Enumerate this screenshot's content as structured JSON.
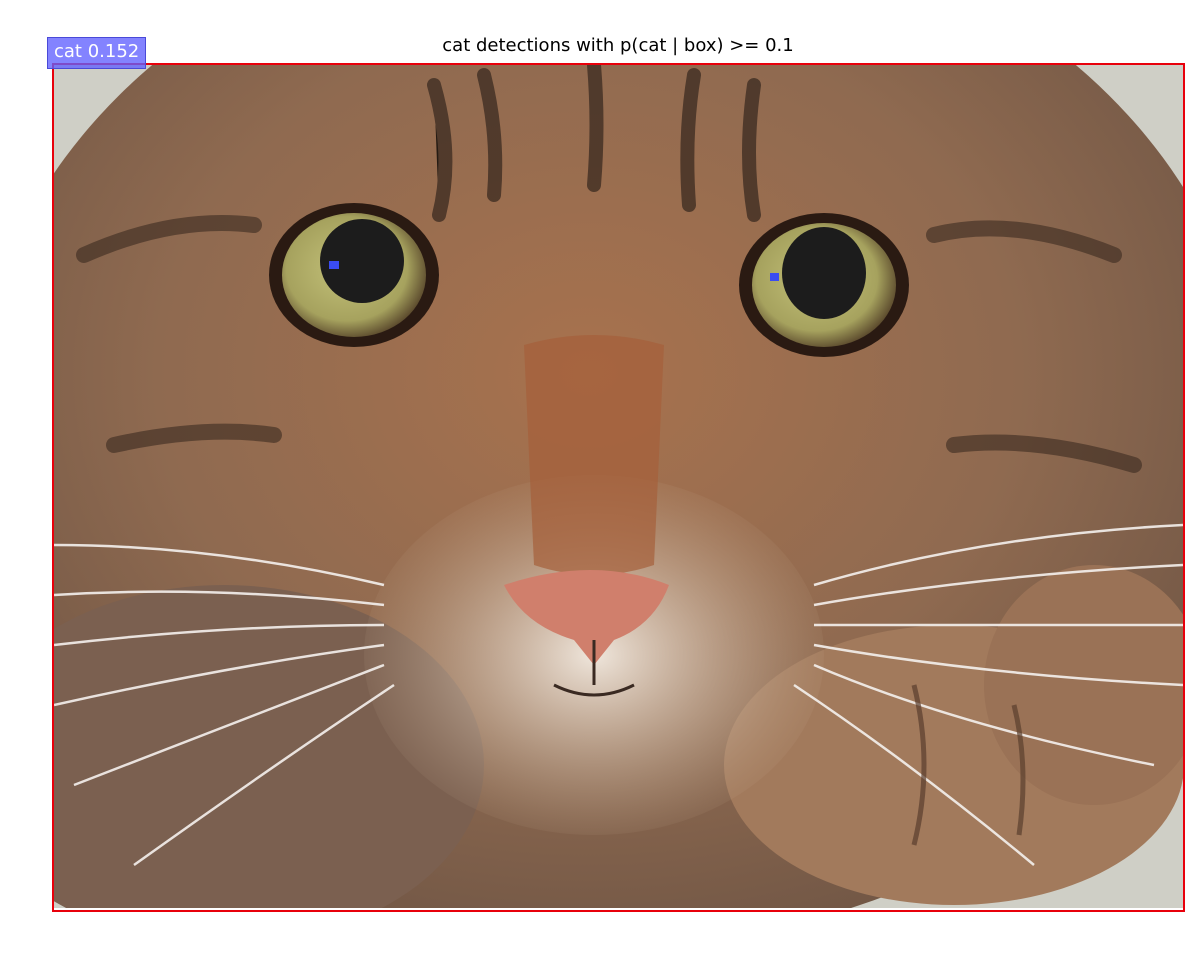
{
  "title": "cat detections with p(cat | box) >= 0.1",
  "detection": {
    "label": "cat 0.152",
    "class": "cat",
    "score": 0.152,
    "box_color": "#e8000b",
    "label_bg": "#6060ff"
  },
  "photo": {
    "subject": "tabby cat face close-up"
  }
}
